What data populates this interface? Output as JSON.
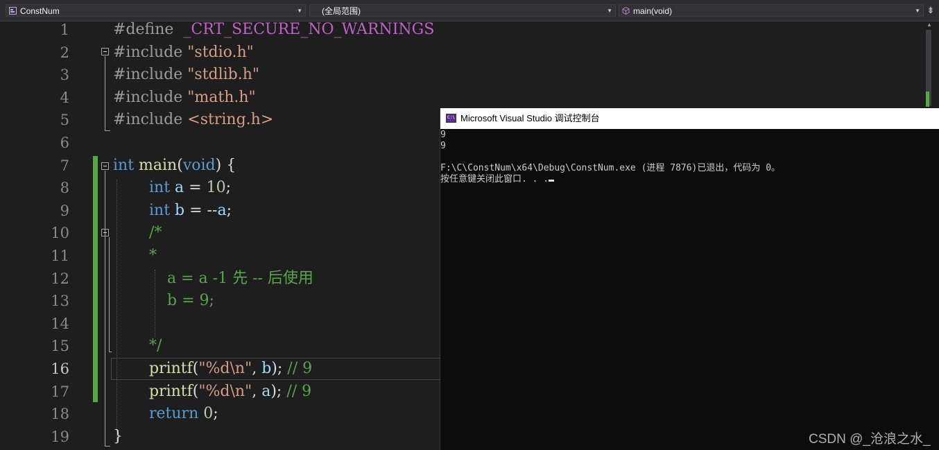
{
  "navbar": {
    "project_dropdown": "ConstNum",
    "scope_dropdown": "(全局范围)",
    "member_dropdown": "main(void)",
    "split_button_icon": "split-window-icon"
  },
  "editor": {
    "line_numbers": [
      "1",
      "2",
      "3",
      "4",
      "5",
      "6",
      "7",
      "8",
      "9",
      "10",
      "11",
      "12",
      "13",
      "14",
      "15",
      "16",
      "17",
      "18",
      "19"
    ],
    "current_line": "16",
    "code": {
      "l1_directive": "#define",
      "l1_macro": "_CRT_SECURE_NO_WARNINGS",
      "l2_directive": "#include",
      "l2_file": "\"stdio.h\"",
      "l3_directive": "#include",
      "l3_file": "\"stdlib.h\"",
      "l4_directive": "#include",
      "l4_file": "\"math.h\"",
      "l5_directive": "#include",
      "l5_file": "<string.h>",
      "l7_type": "int",
      "l7_name": "main",
      "l7_open": "(",
      "l7_param": "void",
      "l7_close": ") {",
      "l8_type": "int",
      "l8_var": "a",
      "l8_op": " = ",
      "l8_num": "10",
      "l8_end": ";",
      "l9_type": "int",
      "l9_var": "b",
      "l9_op": " = --",
      "l9_var2": "a",
      "l9_end": ";",
      "l10_comment": "/*",
      "l11_comment": "*",
      "l12_comment": "a = a -1 先 -- 后使用",
      "l13_comment": "b = 9;",
      "l15_comment": "*/",
      "l16_fn": "printf",
      "l16_open": "(",
      "l16_str": "\"%d\\n\"",
      "l16_mid": ", ",
      "l16_var": "b",
      "l16_end": "); ",
      "l16_comment": "// 9",
      "l17_fn": "printf",
      "l17_open": "(",
      "l17_str": "\"%d\\n\"",
      "l17_mid": ", ",
      "l17_var": "a",
      "l17_end": "); ",
      "l17_comment": "// 9",
      "l18_kw": "return",
      "l18_num": "0",
      "l18_end": ";",
      "l19_brace": "}"
    }
  },
  "console": {
    "title": "Microsoft Visual Studio 调试控制台",
    "output_line1": "9",
    "output_line2": "9",
    "output_line3": "",
    "output_line4": "F:\\C\\ConstNum\\x64\\Debug\\ConstNum.exe (进程 7876)已退出，代码为 0。",
    "output_line5": "按任意键关闭此窗口. . ."
  },
  "watermark": "CSDN @_沧浪之水_",
  "colors": {
    "editor_bg": "#1e1e1e",
    "keyword": "#569cd6",
    "string": "#d69d85",
    "comment": "#57a64a",
    "console_bg": "#0c0c0c"
  }
}
